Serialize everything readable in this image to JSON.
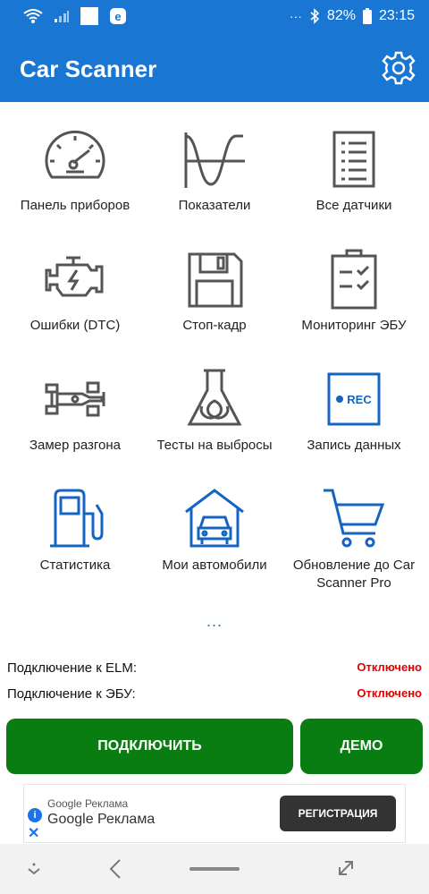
{
  "status_bar": {
    "battery": "82%",
    "time": "23:15",
    "more": "···"
  },
  "app": {
    "title": "Car Scanner"
  },
  "tiles": [
    {
      "label": "Панель приборов",
      "icon": "gauge-icon"
    },
    {
      "label": "Показатели",
      "icon": "waveform-icon"
    },
    {
      "label": "Все датчики",
      "icon": "list-icon"
    },
    {
      "label": "Ошибки (DTC)",
      "icon": "engine-icon"
    },
    {
      "label": "Стоп-кадр",
      "icon": "floppy-disk-icon"
    },
    {
      "label": "Мониторинг ЭБУ",
      "icon": "clipboard-check-icon"
    },
    {
      "label": "Замер разгона",
      "icon": "race-car-icon"
    },
    {
      "label": "Тесты на выбросы",
      "icon": "flask-leaf-icon"
    },
    {
      "label": "Запись данных",
      "icon": "rec-icon"
    },
    {
      "label": "Статистика",
      "icon": "fuel-pump-icon"
    },
    {
      "label": "Мои автомобили",
      "icon": "garage-car-icon"
    },
    {
      "label": "Обновление до Car Scanner Pro",
      "icon": "cart-icon"
    }
  ],
  "more_dots": "...",
  "connection": {
    "elm_label": "Подключение к ELM:",
    "elm_status": "Отключено",
    "ecu_label": "Подключение к ЭБУ:",
    "ecu_status": "Отключено"
  },
  "buttons": {
    "connect": "ПОДКЛЮЧИТЬ",
    "demo": "ДЕМО"
  },
  "ad": {
    "small": "Google Реклама",
    "big": "Google Реклама",
    "cta": "РЕГИСТРАЦИЯ"
  },
  "colors": {
    "primary": "#1976d2",
    "button_green": "#0a7d12",
    "status_red": "#e00000",
    "icon_gray": "#555555",
    "icon_blue": "#1565c0"
  }
}
